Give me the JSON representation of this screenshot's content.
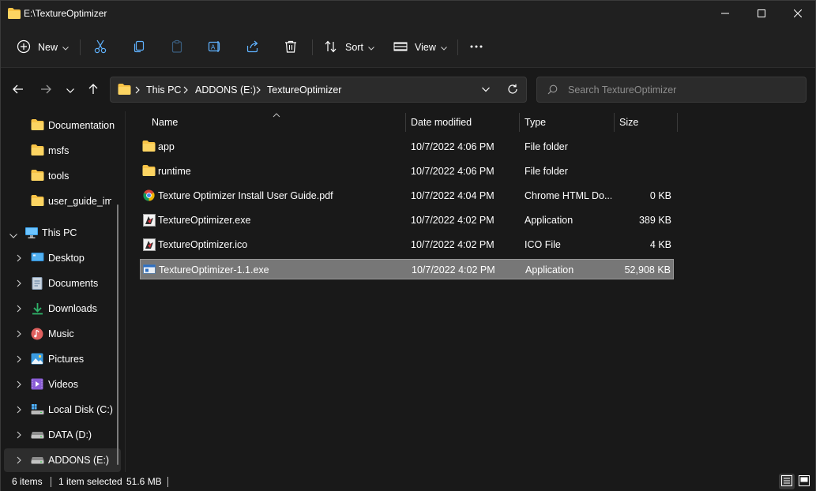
{
  "window": {
    "title": "E:\\TextureOptimizer",
    "controls": {
      "minimize": "minimize",
      "maximize": "maximize",
      "close": "close"
    }
  },
  "commandbar": {
    "new_label": "New",
    "sort_label": "Sort",
    "view_label": "View",
    "icons": [
      "plus-icon",
      "cut-icon",
      "copy-icon",
      "paste-icon",
      "rename-icon",
      "share-icon",
      "delete-icon",
      "sort-icon",
      "view-icon",
      "more-icon"
    ]
  },
  "address": {
    "breadcrumbs": [
      "This PC",
      "ADDONS (E:)",
      "TextureOptimizer"
    ],
    "search_placeholder": "Search TextureOptimizer"
  },
  "sidebar": {
    "folders": [
      "Documentation",
      "msfs",
      "tools",
      "user_guide_images"
    ],
    "this_pc_label": "This PC",
    "locations": [
      {
        "label": "Desktop",
        "icon": "desktop-icon"
      },
      {
        "label": "Documents",
        "icon": "documents-icon"
      },
      {
        "label": "Downloads",
        "icon": "downloads-icon"
      },
      {
        "label": "Music",
        "icon": "music-icon"
      },
      {
        "label": "Pictures",
        "icon": "pictures-icon"
      },
      {
        "label": "Videos",
        "icon": "videos-icon"
      },
      {
        "label": "Local Disk (C:)",
        "icon": "windows-drive-icon"
      },
      {
        "label": "DATA (D:)",
        "icon": "drive-icon"
      },
      {
        "label": "ADDONS (E:)",
        "icon": "drive-icon"
      }
    ],
    "selected": "ADDONS (E:)"
  },
  "filelist": {
    "columns": {
      "name": "Name",
      "date": "Date modified",
      "type": "Type",
      "size": "Size"
    },
    "rows": [
      {
        "name": "app",
        "date": "10/7/2022 4:06 PM",
        "type": "File folder",
        "size": "",
        "icon": "folder-icon"
      },
      {
        "name": "runtime",
        "date": "10/7/2022 4:06 PM",
        "type": "File folder",
        "size": "",
        "icon": "folder-icon"
      },
      {
        "name": "Texture Optimizer Install User Guide.pdf",
        "date": "10/7/2022 4:04 PM",
        "type": "Chrome HTML Do...",
        "size": "0 KB",
        "icon": "chrome-icon"
      },
      {
        "name": "TextureOptimizer.exe",
        "date": "10/7/2022 4:02 PM",
        "type": "Application",
        "size": "389 KB",
        "icon": "app-icon"
      },
      {
        "name": "TextureOptimizer.ico",
        "date": "10/7/2022 4:02 PM",
        "type": "ICO File",
        "size": "4 KB",
        "icon": "app-icon"
      },
      {
        "name": "TextureOptimizer-1.1.exe",
        "date": "10/7/2022 4:02 PM",
        "type": "Application",
        "size": "52,908 KB",
        "icon": "installer-icon",
        "selected": true
      }
    ]
  },
  "status": {
    "item_count": "6 items",
    "selection": "1 item selected",
    "selection_size": "51.6 MB"
  },
  "colors": {
    "background": "#191919",
    "chrome": "#202020",
    "folder_yellow": "#f8c346",
    "selection_row": "#777777",
    "text": "#ffffff"
  }
}
